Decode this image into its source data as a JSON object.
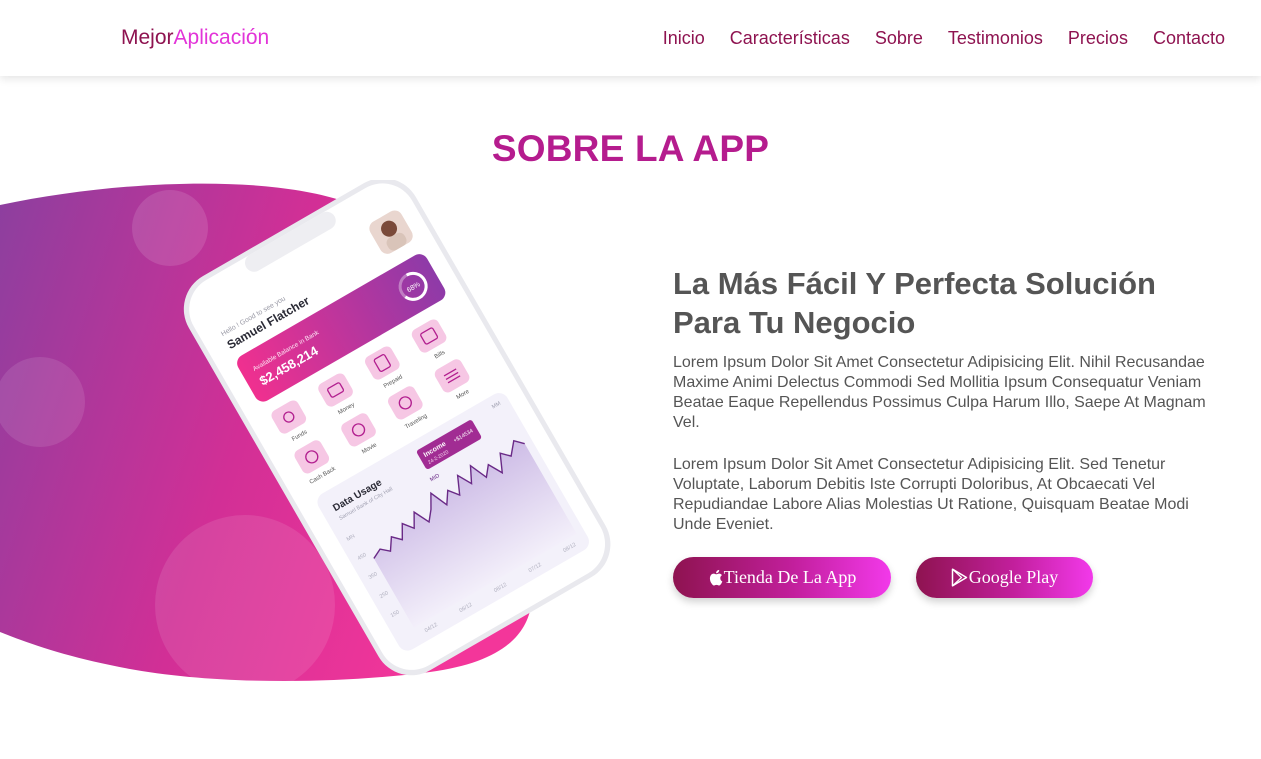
{
  "header": {
    "logo_part1": "Mejor",
    "logo_part2": "Aplicación",
    "nav": [
      "Inicio",
      "Características",
      "Sobre",
      "Testimonios",
      "Precios",
      "Contacto"
    ]
  },
  "section": {
    "title": "SOBRE LA APP"
  },
  "content": {
    "headline_line1": "La Más Fácil Y Perfecta Solución",
    "headline_line2": "Para Tu Negocio",
    "paragraph1": "Lorem Ipsum Dolor Sit Amet Consectetur Adipisicing Elit. Nihil Recusandae Maxime Animi Delectus Commodi Sed Mollitia Ipsum Consequatur Veniam Beatae Eaque Repellendus Possimus Culpa Harum Illo, Saepe At Magnam Vel.",
    "paragraph2": "Lorem Ipsum Dolor Sit Amet Consectetur Adipisicing Elit. Sed Tenetur Voluptate, Laborum Debitis Iste Corrupti Doloribus, At Obcaecati Vel Repudiandae Labore Alias Molestias Ut Ratione, Quisquam Beatae Modi Unde Eveniet."
  },
  "buttons": {
    "apple_label": "Tienda De La App",
    "google_label": "Google Play"
  },
  "phone": {
    "greeting": "Hello ! Good to see you",
    "user_name": "Samuel Flatcher",
    "balance_label": "Available Balance in Bank",
    "balance": "$2,458,214",
    "progress_label": "68%",
    "progress": 0.68,
    "services": [
      "Funds",
      "Money",
      "Prepaid",
      "Bills",
      "Cash Back",
      "Movie",
      "Traveling",
      "More"
    ],
    "chart_title": "Data Usage",
    "chart_subtitle": "Samuel Bank of City Hall",
    "chart_tag_title": "Income",
    "chart_tag_date": "24-2-2020",
    "chart_tag_value": "+$14534",
    "chart_axis_y": [
      "MN",
      "450",
      "350",
      "250",
      "150"
    ],
    "chart_axis_x": [
      "04/12",
      "06/12",
      "08/12",
      "07/12",
      "08/12"
    ],
    "chart_markers": [
      "MID",
      "MM"
    ]
  },
  "colors": {
    "brand_dark": "#8e1350",
    "brand_light": "#e234d8",
    "title": "#b51c8e",
    "gradient_start": "#8e3fa0",
    "gradient_end": "#f0369a"
  }
}
